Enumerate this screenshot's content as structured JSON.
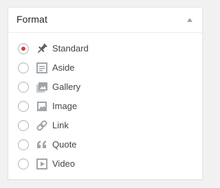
{
  "panel": {
    "title": "Format",
    "toggle_icon": "triangle-up-icon"
  },
  "formats": [
    {
      "label": "Standard",
      "icon": "pin-icon",
      "selected": true
    },
    {
      "label": "Aside",
      "icon": "aside-icon",
      "selected": false
    },
    {
      "label": "Gallery",
      "icon": "gallery-icon",
      "selected": false
    },
    {
      "label": "Image",
      "icon": "image-icon",
      "selected": false
    },
    {
      "label": "Link",
      "icon": "link-icon",
      "selected": false
    },
    {
      "label": "Quote",
      "icon": "quote-icon",
      "selected": false
    },
    {
      "label": "Video",
      "icon": "video-icon",
      "selected": false
    }
  ],
  "colors": {
    "radio_checked": "#dd3d36",
    "icon_gray": "#a0a5aa",
    "pin_dark": "#555d66"
  }
}
